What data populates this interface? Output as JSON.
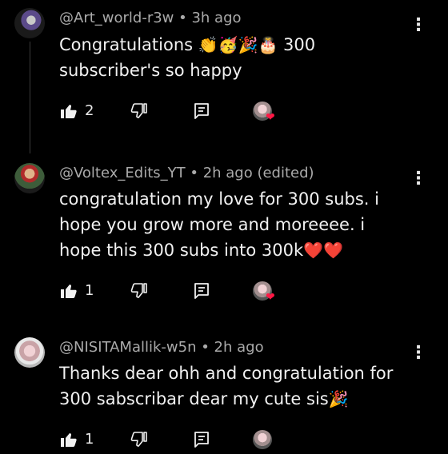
{
  "comments": [
    {
      "author": "@Art_world-r3w",
      "time": "3h ago",
      "text_before": "Congratulations ",
      "emojis": "👏🥳🎉🎂",
      "text_after": " 300 subscriber's so happy",
      "likes": "2"
    },
    {
      "author": "@Voltex_Edits_YT",
      "time": "2h ago (edited)",
      "text": "congratulation my love for 300 subs. i hope you grow more and moreeee. i hope this 300 subs into 300k",
      "emojis": "❤️❤️",
      "likes": "1"
    },
    {
      "author": "@NISITAMallik-w5n",
      "time": "2h ago",
      "text": "Thanks dear ohh and congratulation for 300 sabscribar dear my cute sis",
      "emojis": "🎉",
      "likes": "1"
    }
  ],
  "separator": " • ",
  "icons": {
    "like": "thumbs-up-icon",
    "dislike": "thumbs-down-icon",
    "reply": "reply-icon",
    "menu": "more-vert-icon",
    "creator_heart": "heart-icon"
  },
  "colors": {
    "background": "#000000",
    "text": "#f1f1f1",
    "meta": "#aaaaaa",
    "heart": "#ff1744"
  }
}
